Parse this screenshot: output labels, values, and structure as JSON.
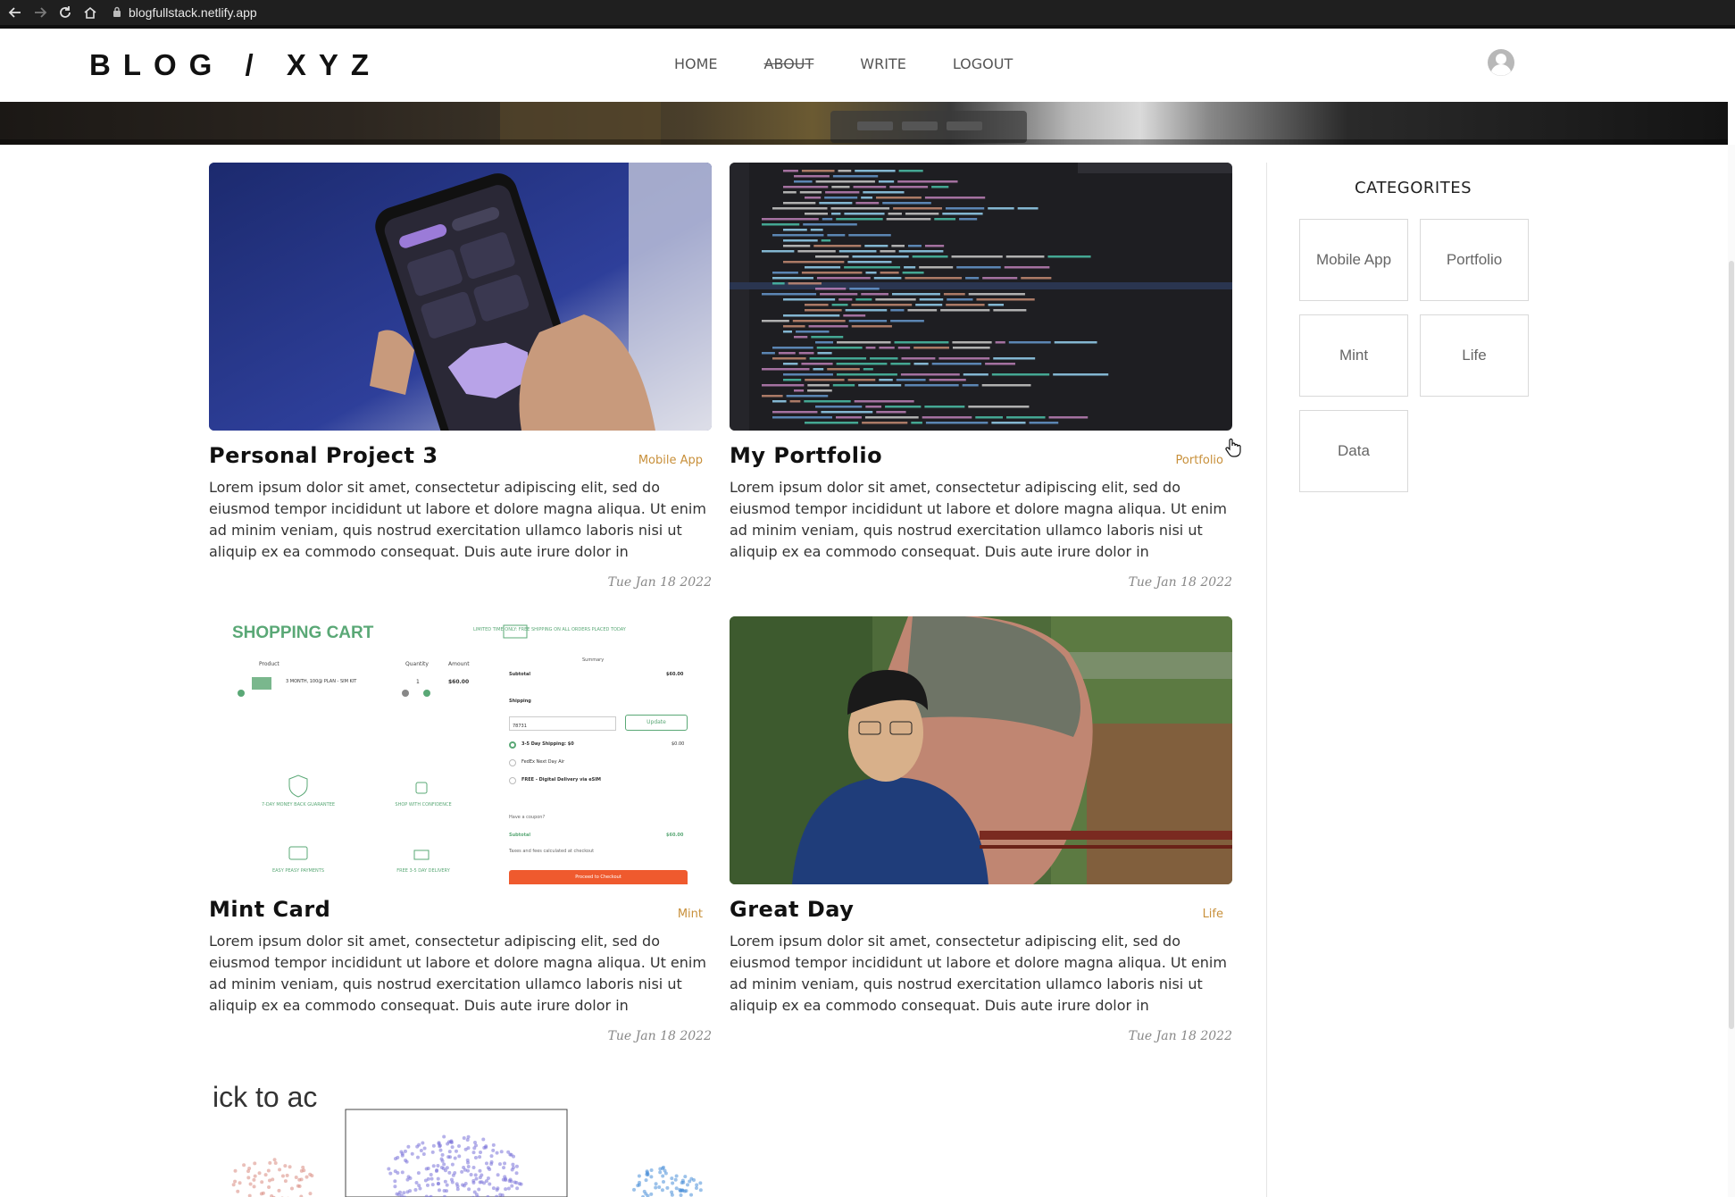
{
  "browser": {
    "url": "blogfullstack.netlify.app"
  },
  "header": {
    "logo": "BLOG / XYZ",
    "nav": [
      "HOME",
      "ABOUT",
      "WRITE",
      "LOGOUT"
    ]
  },
  "posts": [
    {
      "title": "Personal Project 3",
      "category": "Mobile App",
      "excerpt": "Lorem ipsum dolor sit amet, consectetur adipiscing elit, sed do eiusmod tempor incididunt ut labore et dolore magna aliqua. Ut enim ad minim veniam, quis nostrud exercitation ullamco laboris nisi ut aliquip ex ea commodo consequat. Duis aute irure dolor in reprehenderit in voluptate…",
      "date": "Tue Jan 18 2022",
      "image": "phone-covid-map"
    },
    {
      "title": "My Portfolio",
      "category": "Portfolio",
      "excerpt": "Lorem ipsum dolor sit amet, consectetur adipiscing elit, sed do eiusmod tempor incididunt ut labore et dolore magna aliqua. Ut enim ad minim veniam, quis nostrud exercitation ullamco laboris nisi ut aliquip ex ea commodo consequat. Duis aute irure dolor in reprehenderit in voluptate…",
      "date": "Tue Jan 18 2022",
      "image": "code-editor"
    },
    {
      "title": "Mint Card",
      "category": "Mint",
      "excerpt": "Lorem ipsum dolor sit amet, consectetur adipiscing elit, sed do eiusmod tempor incididunt ut labore et dolore magna aliqua. Ut enim ad minim veniam, quis nostrud exercitation ullamco laboris nisi ut aliquip ex ea commodo consequat. Duis aute irure dolor in reprehenderit in voluptate…",
      "date": "Tue Jan 18 2022",
      "image": "shopping-cart",
      "cart": {
        "heading": "SHOPPING CART",
        "product_col": "Product",
        "quantity_col": "Quantity",
        "amount_col": "Amount",
        "item": "3 MONTH, 100@ PLAN - SIM KIT",
        "qty": "1",
        "amount": "$60.00",
        "promo": "LIMITED TIME ONLY: FREE SHIPPING ON ALL ORDERS PLACED TODAY",
        "summary": "Summary",
        "subtotal_label": "Subtotal",
        "subtotal": "$60.00",
        "shipping": "Shipping",
        "zip": "78731",
        "update": "Update",
        "ship1": "3-5 Day Shipping: $0",
        "ship1_price": "$0.00",
        "ship2": "FedEx Next Day Air",
        "ship3": "FREE - Digital Delivery via eSIM",
        "coupon": "Have a coupon?",
        "taxes": "Taxes and fees calculated at checkout",
        "checkout": "Proceed to Checkout",
        "badges": [
          "7-DAY MONEY BACK GUARANTEE",
          "SHOP WITH CONFIDENCE",
          "EASY PEASY PAYMENTS",
          "FREE 3-5 DAY DELIVERY"
        ]
      }
    },
    {
      "title": "Great Day",
      "category": "Life",
      "excerpt": "Lorem ipsum dolor sit amet, consectetur adipiscing elit, sed do eiusmod tempor incididunt ut labore et dolore magna aliqua. Ut enim ad minim veniam, quis nostrud exercitation ullamco laboris nisi ut aliquip ex ea commodo consequat. Duis aute irure dolor in reprehenderit in voluptate…",
      "date": "Tue Jan 18 2022",
      "image": "person-buddha-statue"
    }
  ],
  "partial_post": {
    "text": "ick to ac"
  },
  "sidebar": {
    "title": "CATEGORITES",
    "categories": [
      "Mobile App",
      "Portfolio",
      "Mint",
      "Life",
      "Data"
    ]
  },
  "colors": {
    "category_accent": "#c8903b",
    "cart_green": "#5aa876",
    "checkout_orange": "#ef5a2e"
  }
}
